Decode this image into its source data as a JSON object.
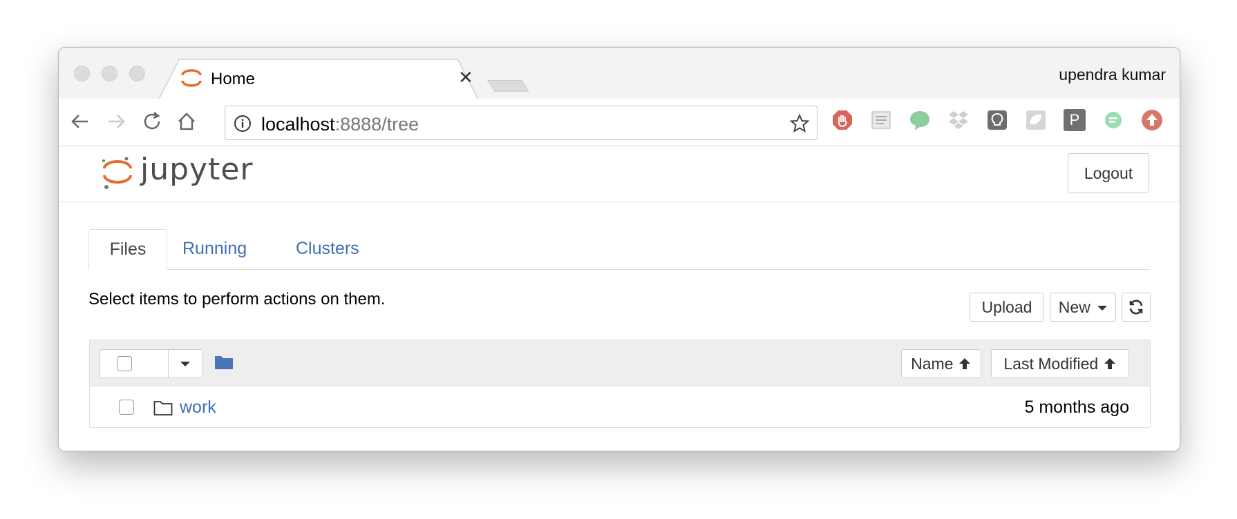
{
  "browser": {
    "tab_title": "Home",
    "user": "upendra kumar",
    "url_host": "localhost",
    "url_rest": ":8888/tree",
    "extensions": [
      "adblock-icon",
      "notes-icon",
      "chat-bubble-icon",
      "dropbox-icon",
      "lightbulb-icon",
      "cloud-icon",
      "p-icon",
      "chat-green-icon",
      "upload-icon"
    ],
    "extension_p_label": "P"
  },
  "header": {
    "logo_text": "jupyter",
    "logout_label": "Logout"
  },
  "tabs": [
    {
      "label": "Files",
      "active": true
    },
    {
      "label": "Running",
      "active": false
    },
    {
      "label": "Clusters",
      "active": false
    }
  ],
  "toolbar": {
    "instructions": "Select items to perform actions on them.",
    "upload_label": "Upload",
    "new_label": "New"
  },
  "list": {
    "sort_name_label": "Name",
    "sort_modified_label": "Last Modified",
    "rows": [
      {
        "name": "work",
        "modified": "5 months ago",
        "type": "folder"
      }
    ]
  },
  "colors": {
    "link": "#3f6fb3",
    "jupyter_orange": "#e46e2e",
    "folder_blue": "#4a76b8"
  }
}
